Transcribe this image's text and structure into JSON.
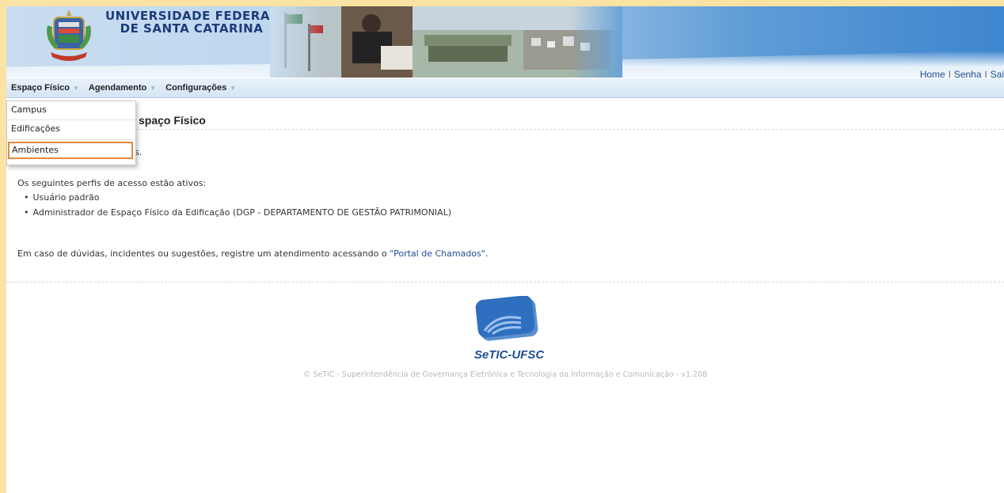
{
  "header": {
    "university_line1": "UNIVERSIDADE FEDERAL",
    "university_line2": "DE SANTA CATARINA",
    "links": [
      "Home",
      "Senha",
      "Sai"
    ]
  },
  "menu": {
    "items": [
      {
        "label": "Espaço Físico"
      },
      {
        "label": "Agendamento"
      },
      {
        "label": "Configurações"
      }
    ]
  },
  "dropdown": {
    "items": [
      "Campus",
      "Edificações",
      "Ambientes"
    ],
    "highlighted": "Ambientes"
  },
  "content": {
    "title_visible": "spaço Físico",
    "welcome_visible": "s.",
    "profiles_intro": "Os seguintes perfis de acesso estão ativos:",
    "profiles": [
      "Usuário padrão",
      "Administrador de Espaço Físico da Edificação (DGP - DEPARTAMENTO DE GESTÃO PATRIMONIAL)"
    ],
    "help_prefix": "Em caso de dúvidas, incidentes ou sugestões, registre um atendimento acessando o ",
    "help_link": "\"Portal de Chamados\"",
    "help_suffix": "."
  },
  "footer": {
    "logo_text": "SeTIC-UFSC",
    "copyright": "© SeTIC - Superintendência de Governança Eletrônica e Tecnologia da Informação e Comunicação - v1.208"
  },
  "colors": {
    "accent": "#1f4f94",
    "highlight_border": "#e3893e",
    "page_background": "#fbe3a3"
  }
}
